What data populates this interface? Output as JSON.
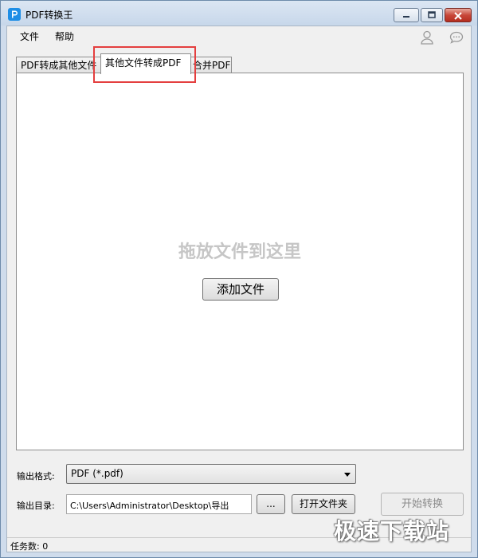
{
  "window": {
    "title": "PDF转换王",
    "icon": "app-logo-icon"
  },
  "menu": {
    "file_label": "文件",
    "help_label": "帮助"
  },
  "header_icons": {
    "user": "user-icon",
    "chat": "chat-icon"
  },
  "tabs": [
    {
      "label": "PDF转成其他文件",
      "active": false
    },
    {
      "label": "其他文件转成PDF",
      "active": true
    },
    {
      "label": "合并PDF",
      "active": false
    }
  ],
  "drop_area": {
    "hint": "拖放文件到这里",
    "add_button_label": "添加文件"
  },
  "output": {
    "format_label": "输出格式:",
    "format_value": "PDF (*.pdf)",
    "dir_label": "输出目录:",
    "dir_value": "C:\\Users\\Administrator\\Desktop\\导出",
    "browse_label": "...",
    "open_folder_label": "打开文件夹",
    "start_label": "开始转换"
  },
  "status": {
    "text": "任务数: 0"
  },
  "watermark": "极速下载站",
  "colors": {
    "highlight": "#e43f3f",
    "app_icon": "#1e8ee6",
    "close_button": "#c8483a"
  }
}
